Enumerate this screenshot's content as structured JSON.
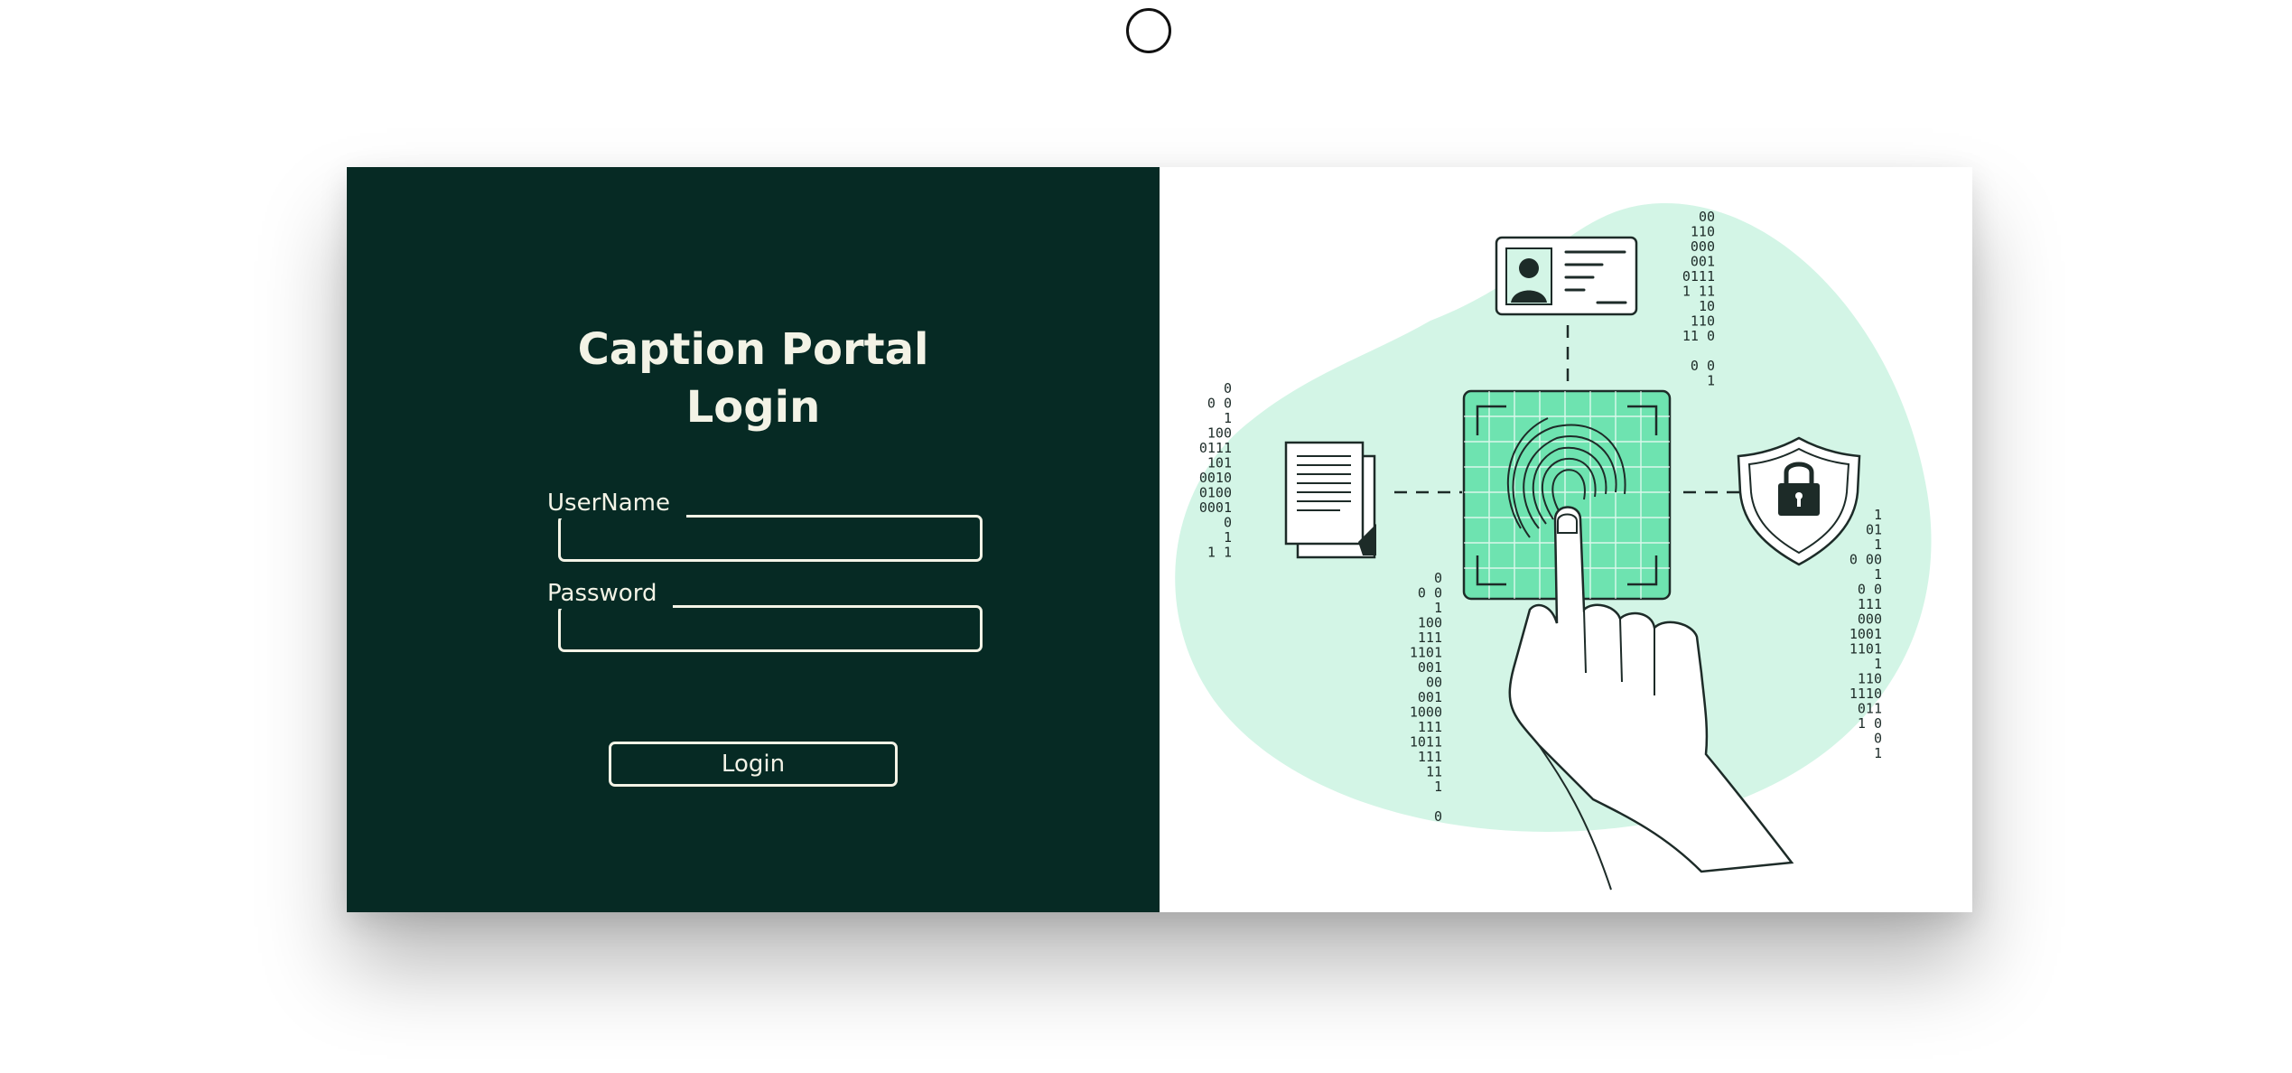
{
  "login": {
    "title_line1": "Caption Portal",
    "title_line2": "Login",
    "username_label": "UserName",
    "password_label": "Password",
    "submit_label": "Login"
  },
  "illustration": {
    "description_icon_names": [
      "id-card-icon",
      "document-icon",
      "fingerprint-icon",
      "shield-lock-icon",
      "hand-icon"
    ],
    "accent_color": "#6ee3b0",
    "blob_color": "#d3f5e6",
    "binary": {
      "left": [
        "0",
        "0 0",
        "1",
        "100",
        "0111",
        "101",
        "0010",
        "0100",
        "0001",
        "0",
        "1",
        "1 1"
      ],
      "top": [
        "00",
        "110",
        "000",
        "001",
        "0111",
        "1 11",
        "10",
        "110",
        "11 0",
        "",
        "0 0",
        "1"
      ],
      "center": [
        "0",
        "0 0",
        "1",
        "100",
        "111",
        "1101",
        "001",
        "00",
        "001",
        "1000",
        "111",
        "1011",
        "111",
        "11",
        "1",
        "",
        "0"
      ],
      "right": [
        "1",
        "01",
        "1",
        "0 00",
        "1",
        "0 0",
        "111",
        "000",
        "1001",
        "1101",
        "1",
        "110",
        "1110",
        "011",
        "1 0",
        "0",
        "1"
      ]
    }
  },
  "colors": {
    "left_panel_bg": "#062a24",
    "text_color": "#f3f3e6"
  }
}
